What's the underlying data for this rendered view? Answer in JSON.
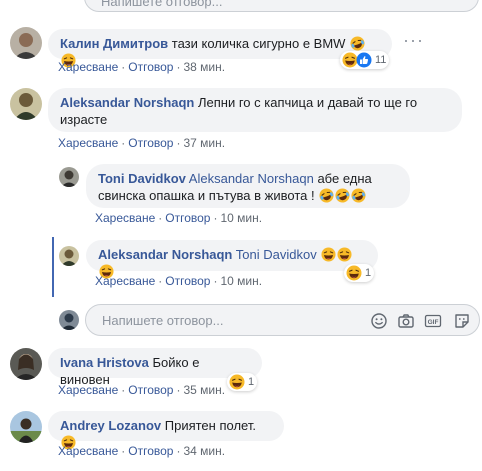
{
  "top_input": {
    "placeholder": "Напишете отговор..."
  },
  "comments": [
    {
      "author": "Калин Димитров",
      "text": "тази количка сигурно е BMW",
      "like": "Харесване",
      "reply": "Отговор",
      "time": "38 мин.",
      "reaction_count": "11",
      "emojis": [
        "laugh-cry",
        "laugh"
      ]
    },
    {
      "author": "Aleksandar Norshaqn",
      "text": "Лепни го с капчица и давай то ще го израсте",
      "like": "Харесване",
      "reply": "Отговор",
      "time": "37 мин."
    },
    {
      "author": "Toni Davidkov",
      "mention": "Aleksandar Norshaqn",
      "text": "абе една свинска опашка и пътува в живота !",
      "like": "Харесване",
      "reply": "Отговор",
      "time": "10 мин.",
      "emojis": [
        "laugh-cry",
        "laugh-cry",
        "laugh-cry"
      ]
    },
    {
      "author": "Aleksandar Norshaqn",
      "mention": "Toni Davidkov",
      "like": "Харесване",
      "reply": "Отговор",
      "time": "10 мин.",
      "reaction_count": "1",
      "emojis": [
        "laugh",
        "laugh",
        "laugh"
      ]
    },
    {
      "author": "Ivana Hristova",
      "text": "Бойко е виновен",
      "like": "Харесване",
      "reply": "Отговор",
      "time": "35 мин.",
      "reaction_count": "1"
    },
    {
      "author": "Andrey Lozanov",
      "text": "Приятен полет.",
      "like": "Харесване",
      "reply": "Отговор",
      "time": "34 мин.",
      "emojis": [
        "laugh"
      ]
    }
  ],
  "reply_input": {
    "placeholder": "Напишете отговор...",
    "icons": [
      "smiley-icon",
      "camera-icon",
      "gif-icon",
      "sticker-icon"
    ],
    "gif_label": "GIF"
  },
  "colors": {
    "link": "#385898",
    "bubble": "#f2f3f5",
    "meta": "#606770",
    "thread": "#4267b2"
  }
}
